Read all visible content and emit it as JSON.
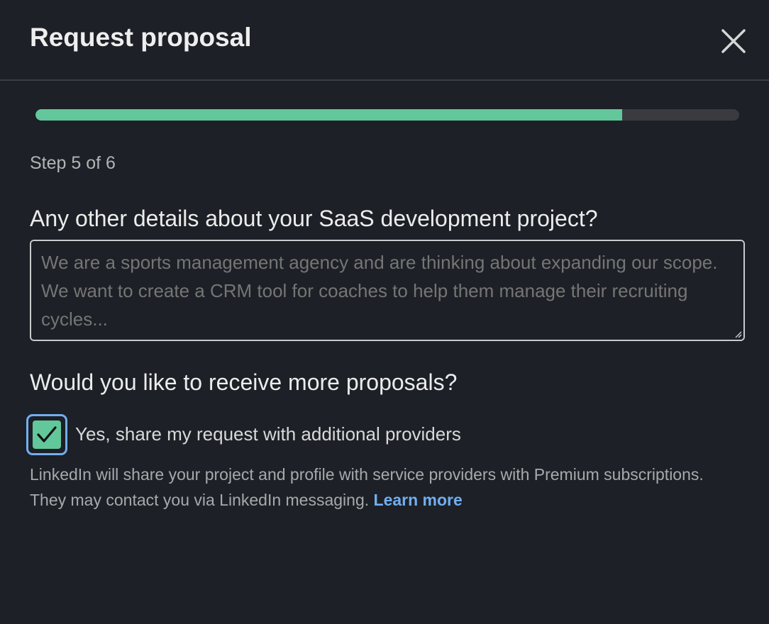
{
  "dialog": {
    "title": "Request proposal",
    "close_icon": "close-icon"
  },
  "progress": {
    "current_step": 5,
    "total_steps": 6,
    "fraction": 0.833,
    "color": "#62c79b",
    "step_label": "Step 5 of 6"
  },
  "details": {
    "question": "Any other details about your SaaS development project?",
    "placeholder": "We are a sports management agency and are thinking about expanding our scope. We want to create a CRM tool for coaches to help them manage their recruiting cycles..."
  },
  "proposals": {
    "question": "Would you like to receive more proposals?",
    "checkbox_label": "Yes, share my request with additional providers",
    "checked": true,
    "help_text": "LinkedIn will share your project and profile with service providers with Premium subscriptions. They may contact you via LinkedIn messaging. ",
    "learn_more": "Learn more"
  }
}
